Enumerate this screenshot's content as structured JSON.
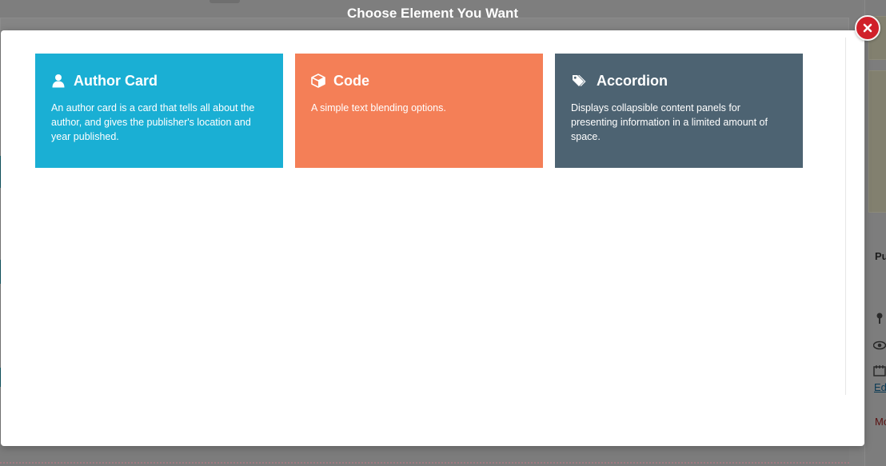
{
  "modal": {
    "title": "Choose Element You Want"
  },
  "elements": [
    {
      "title": "Author Card",
      "description": "An author card is a card that tells all about the author, and gives the publisher's location and year published.",
      "icon": "user-icon",
      "color": "#1aafd4"
    },
    {
      "title": "Code",
      "description": "A simple text blending options.",
      "icon": "cube-icon",
      "color": "#f47f57"
    },
    {
      "title": "Accordion",
      "description": "Displays collapsible content panels for presenting information in a limited amount of space.",
      "icon": "tags-icon",
      "color": "#4d6372"
    }
  ],
  "close_button": {
    "icon": "close-icon",
    "color": "#d0202a"
  },
  "background": {
    "sidebar_heading": "Pu",
    "sidebar_link": "Ed",
    "sidebar_red_text": "Mo"
  }
}
